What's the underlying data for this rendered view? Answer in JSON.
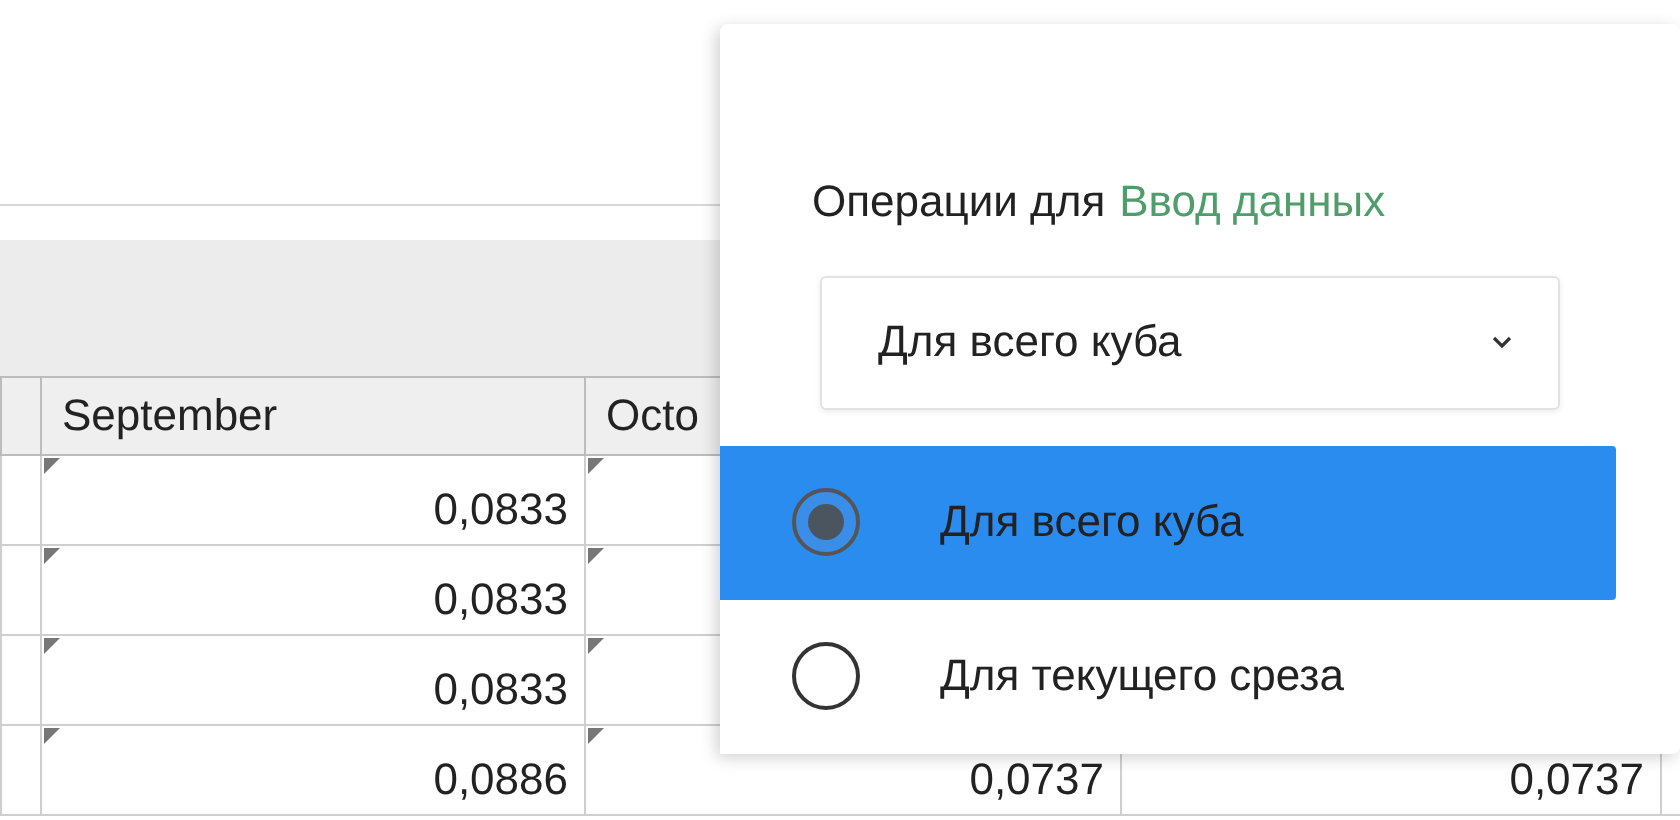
{
  "table": {
    "columns": [
      {
        "label": "September"
      },
      {
        "label": "Octo"
      }
    ],
    "rows": [
      {
        "cells": [
          "0,0833"
        ]
      },
      {
        "cells": [
          "0,0833"
        ]
      },
      {
        "cells": [
          "0,0833"
        ]
      },
      {
        "cells": [
          "0,0886",
          "0,0737",
          "0,0737"
        ]
      }
    ]
  },
  "popup": {
    "title": "Операции для",
    "target": "Ввод данных",
    "select": {
      "value": "Для всего куба"
    },
    "options": [
      {
        "label": "Для всего куба",
        "selected": true
      },
      {
        "label": "Для текущего среза",
        "selected": false
      }
    ]
  }
}
